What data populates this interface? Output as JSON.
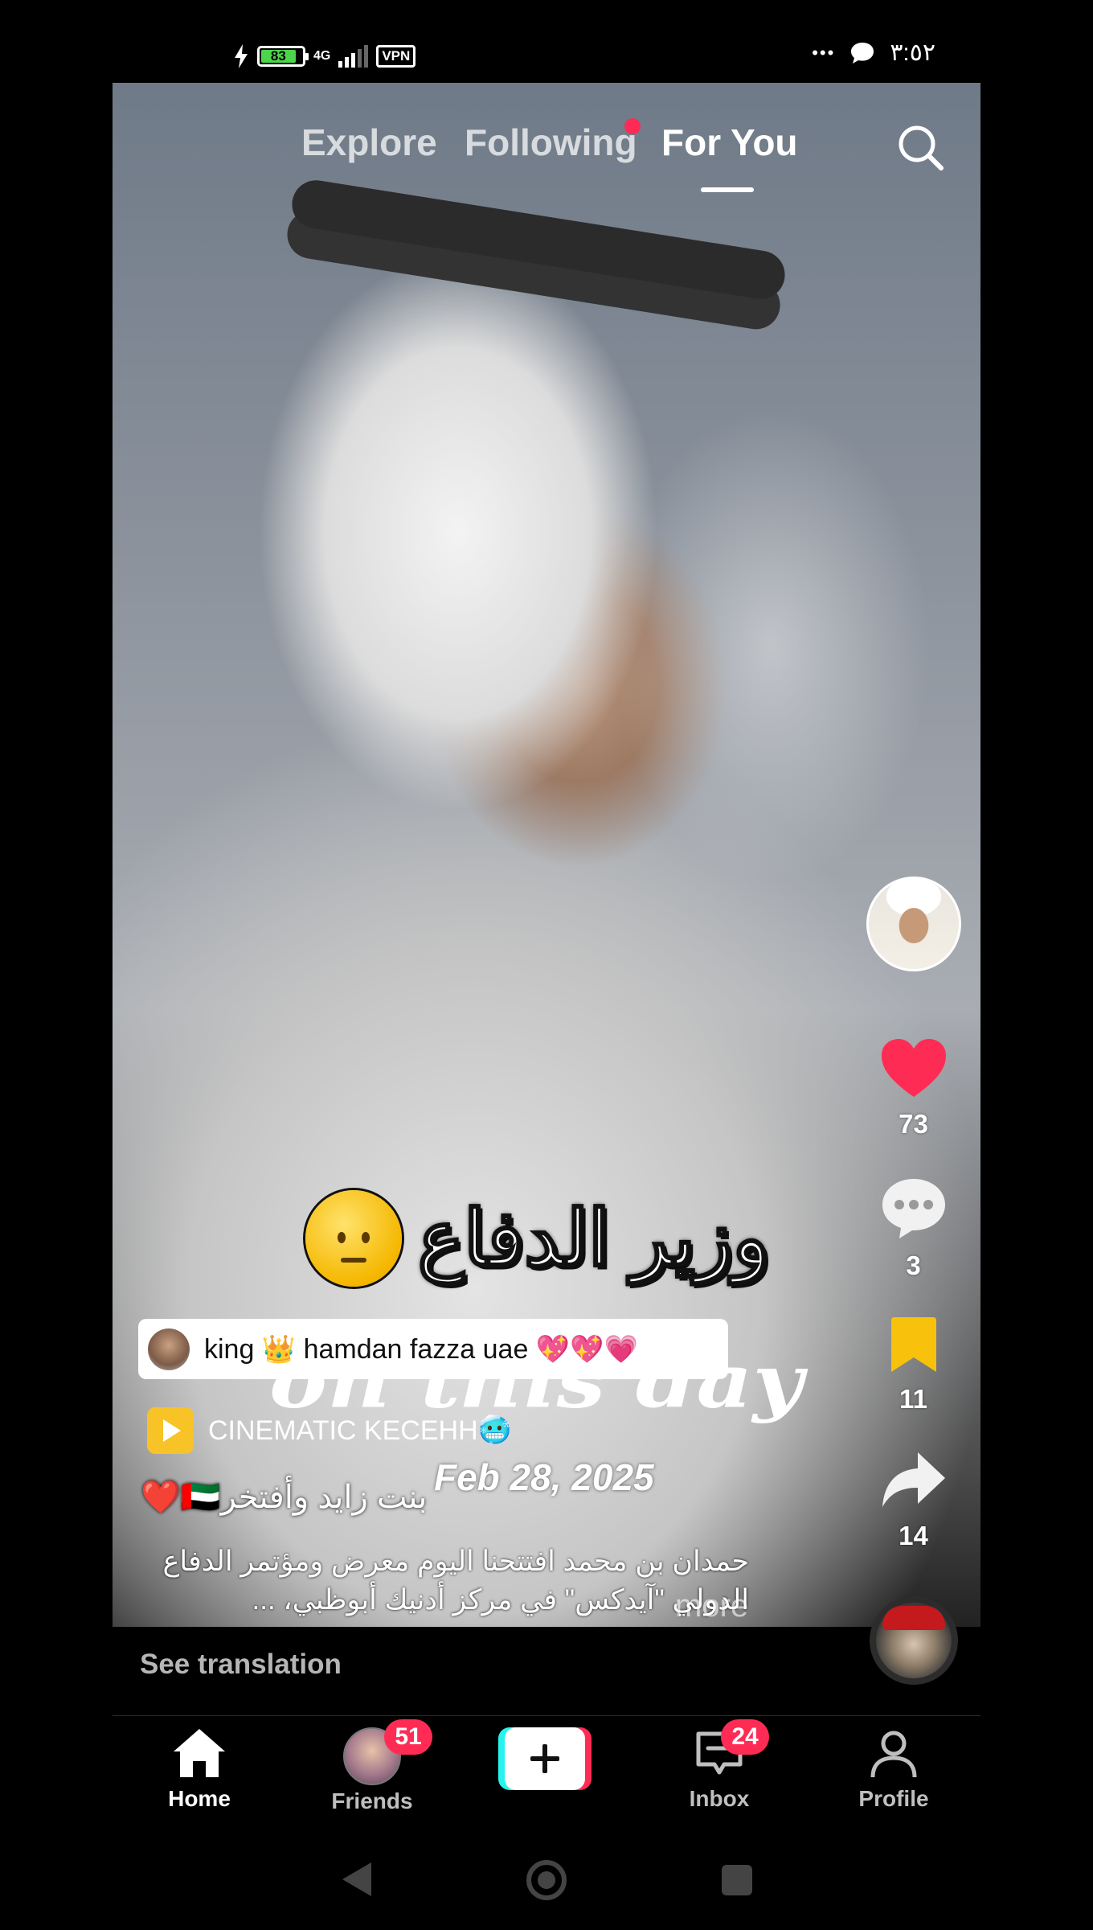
{
  "status_bar": {
    "battery": "83",
    "battery_level": 0.83,
    "network": "4G",
    "vpn": "VPN",
    "more": "•••",
    "time": "٣:٥٢"
  },
  "top_nav": {
    "tabs": [
      "Explore",
      "Following",
      "For You"
    ],
    "active": "For You"
  },
  "video_overlay": {
    "title": "وزير الدفاع",
    "watermark": "on this day",
    "date": "Feb 28, 2025",
    "more": "more"
  },
  "mention": {
    "text": "king 👑 hamdan fazza uae 💖💖💗"
  },
  "creator_tool": {
    "label": "CINEMATIC KECEHH🥶"
  },
  "post": {
    "username": "بنت زايد وأفتخر🇦🇪❤️",
    "caption": "حمدان بن محمد افتتحنا اليوم معرض ومؤتمر الدفاع الدولي \"آيدكس\" في مركز أدنيك أبوظبي، ..."
  },
  "translation": {
    "label": "See translation"
  },
  "side_rail": {
    "likes": "73",
    "comments": "3",
    "saves": "11",
    "shares": "14"
  },
  "bottom_nav": {
    "home": "Home",
    "friends": "Friends",
    "friends_badge": "51",
    "inbox": "Inbox",
    "inbox_badge": "24",
    "profile": "Profile"
  },
  "colors": {
    "accent": "#fe2c55",
    "cyan": "#25f4ee",
    "save": "#f8c10b",
    "battery": "#4cd44c"
  }
}
